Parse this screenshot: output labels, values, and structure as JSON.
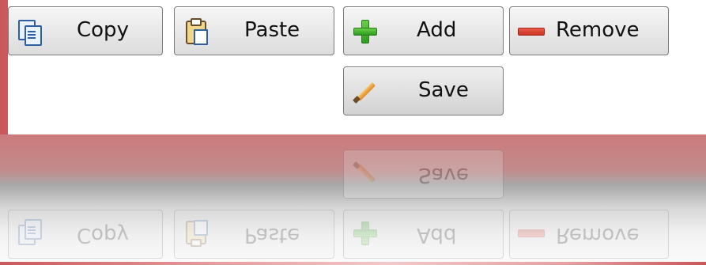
{
  "toolbar": {
    "buttons": [
      {
        "key": "copy",
        "label": "Copy",
        "icon": "copy-icon"
      },
      {
        "key": "paste",
        "label": "Paste",
        "icon": "paste-icon"
      },
      {
        "key": "add",
        "label": "Add",
        "icon": "plus-icon"
      },
      {
        "key": "remove",
        "label": "Remove",
        "icon": "minus-icon"
      },
      {
        "key": "save",
        "label": "Save",
        "icon": "pencil-icon"
      }
    ]
  },
  "colors": {
    "background_left": "#c9585b",
    "background_center": "#f3c7c8",
    "panel": "#ffffff",
    "button_border": "#7a7a7a",
    "button_top": "#f6f6f6",
    "button_bottom": "#dcdcdc"
  }
}
